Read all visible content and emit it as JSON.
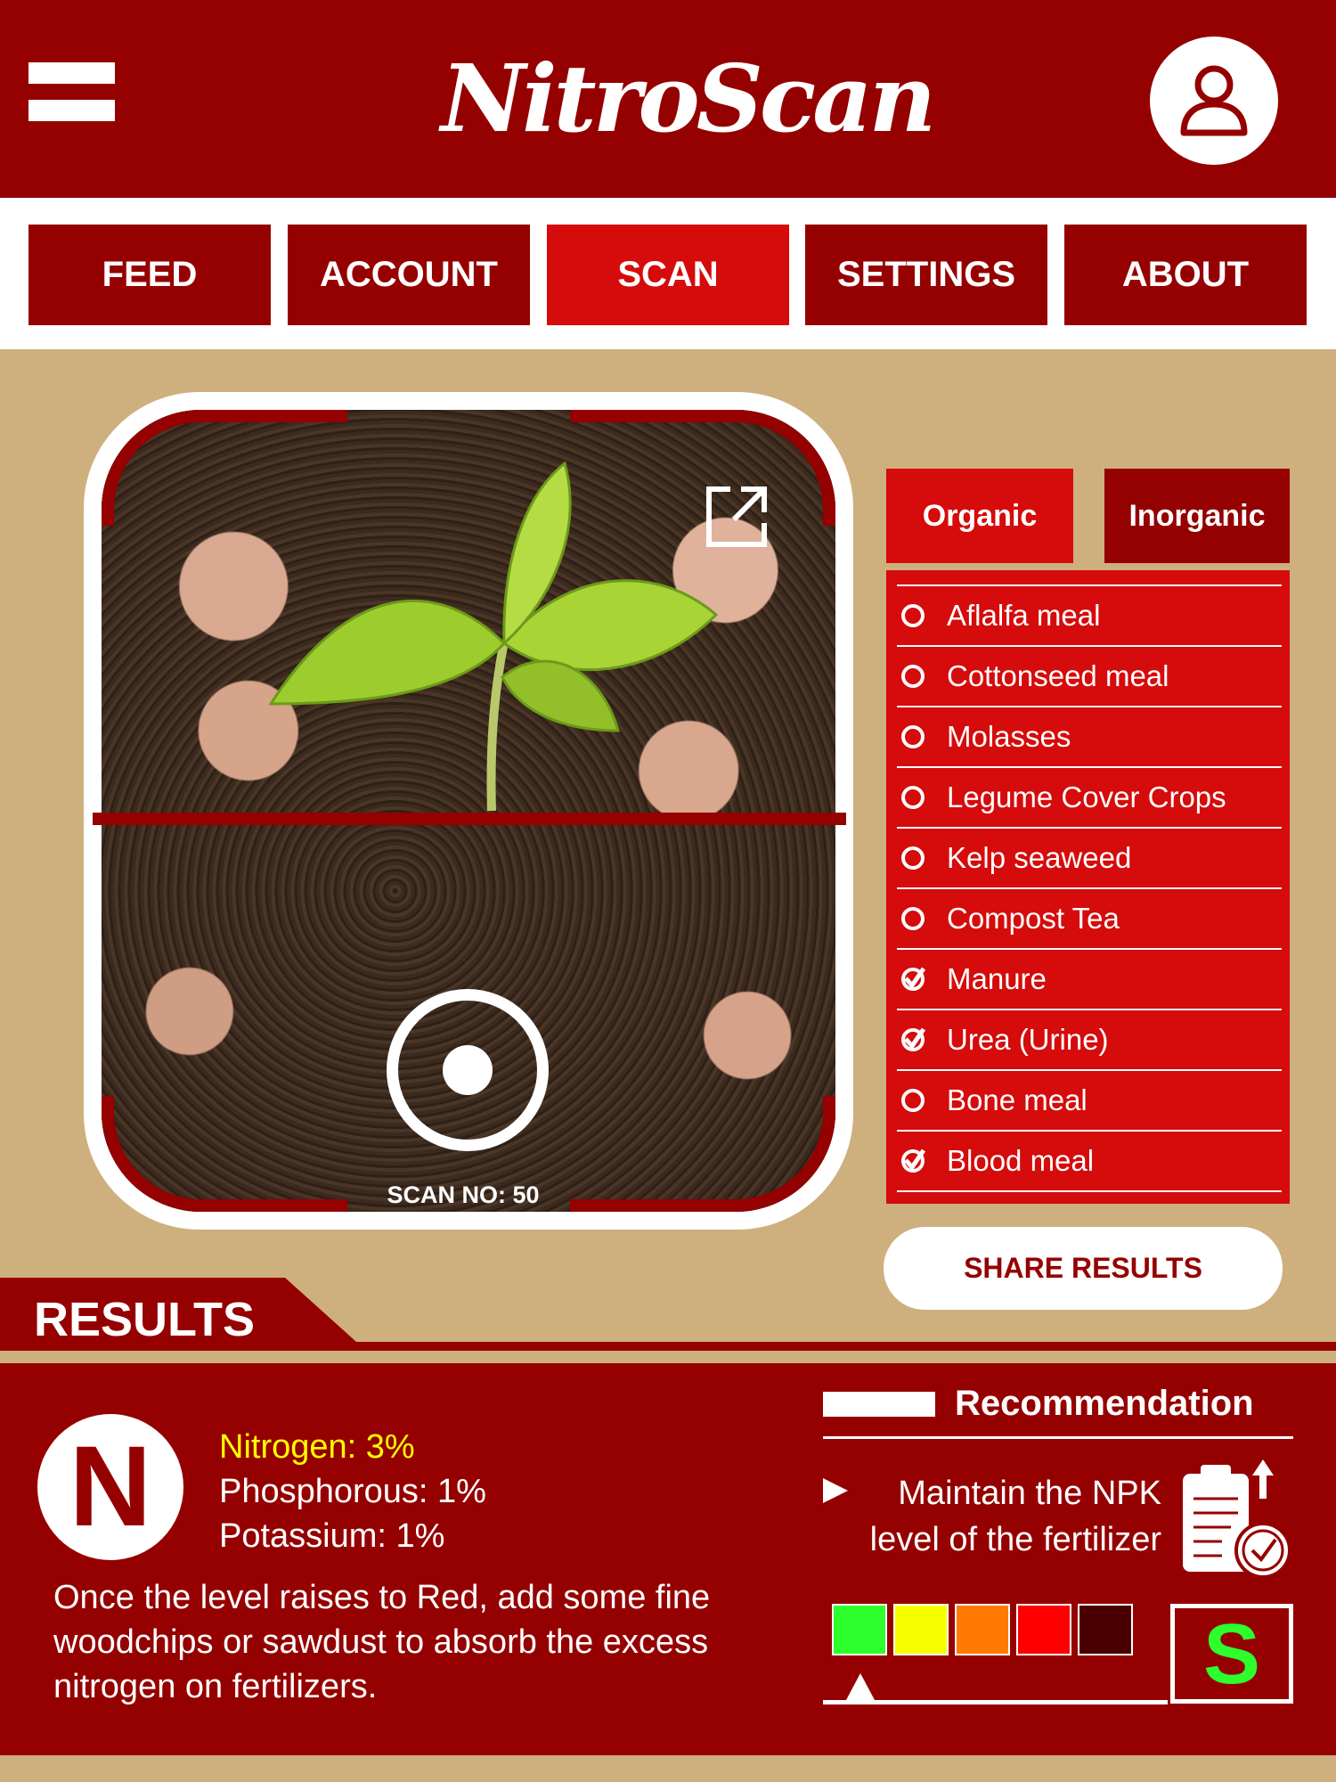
{
  "app": {
    "title": "NitroScan"
  },
  "nav": {
    "tabs": [
      {
        "label": "FEED"
      },
      {
        "label": "ACCOUNT"
      },
      {
        "label": "SCAN"
      },
      {
        "label": "SETTINGS"
      },
      {
        "label": "ABOUT"
      }
    ],
    "active": "SCAN"
  },
  "scanner": {
    "scan_number_label": "SCAN NO: 50"
  },
  "categories": {
    "organic": "Organic",
    "inorganic": "Inorganic",
    "selected": "Organic"
  },
  "fertilizers": [
    {
      "label": "Aflalfa meal",
      "checked": false
    },
    {
      "label": "Cottonseed meal",
      "checked": false
    },
    {
      "label": "Molasses",
      "checked": false
    },
    {
      "label": "Legume Cover Crops",
      "checked": false
    },
    {
      "label": "Kelp seaweed",
      "checked": false
    },
    {
      "label": "Compost Tea",
      "checked": false
    },
    {
      "label": "Manure",
      "checked": true
    },
    {
      "label": "Urea (Urine)",
      "checked": true
    },
    {
      "label": "Bone meal",
      "checked": false
    },
    {
      "label": "Blood meal",
      "checked": true
    }
  ],
  "share": {
    "label": "SHARE RESULTS"
  },
  "results": {
    "title": "RESULTS",
    "badge": "N",
    "nitrogen": "Nitrogen: 3%",
    "phosphorous": "Phosphorous: 1%",
    "potassium": "Potassium: 1%",
    "advice": "Once the level raises to Red, add some fine woodchips or sawdust to absorb the excess nitrogen on fertilizers."
  },
  "recommendation": {
    "title": "Recommendation",
    "text_line1": "Maintain the NPK",
    "text_line2": "level of the fertilizer",
    "levels": [
      "#2CFF2C",
      "#F5FF00",
      "#FF7A00",
      "#FF0000",
      "#4A0000"
    ],
    "current_level": 1,
    "grade": "S"
  },
  "colors": {
    "brand": "#950000",
    "accent": "#D60B0B",
    "background": "#CEAF7E"
  }
}
